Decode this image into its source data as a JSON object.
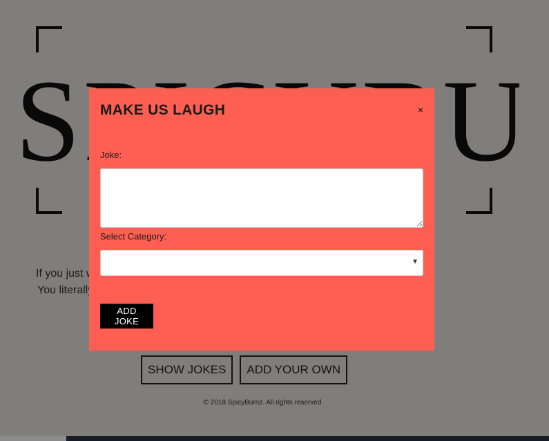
{
  "background": {
    "logo_text": "SPICYBURNZ",
    "intro_line_1": "If you just w",
    "intro_line_2": "You literally",
    "show_jokes_label": "SHOW JOKES",
    "add_your_own_label": "ADD YOUR OWN",
    "footer": "© 2018 SpicyBurnz. All rights reserved"
  },
  "modal": {
    "title": "MAKE US LAUGH",
    "close_label": "×",
    "joke_label": "Joke:",
    "joke_value": "",
    "category_label": "Select Category:",
    "category_selected": "",
    "submit_label": "ADD JOKE"
  },
  "colors": {
    "modal_bg": "#ff5f52",
    "overlay": "rgba(0,0,0,0.45)",
    "button_bg": "#000000"
  }
}
